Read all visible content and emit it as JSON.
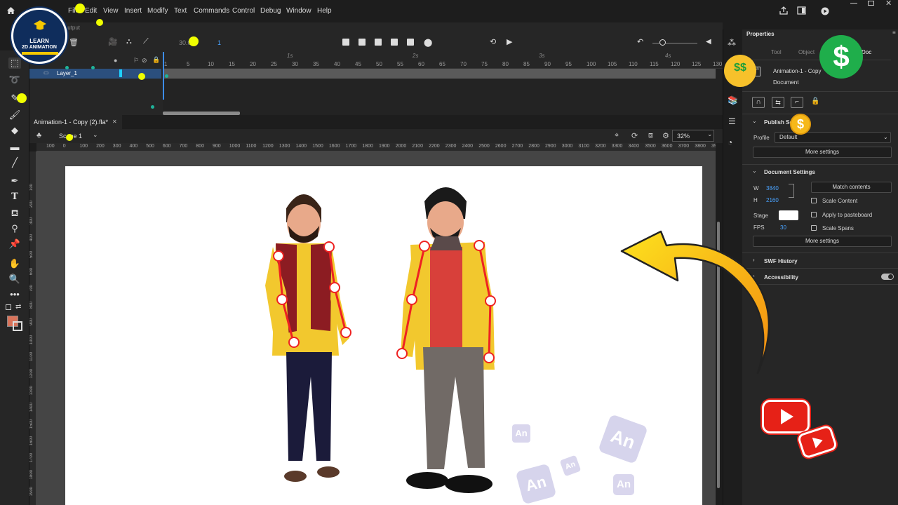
{
  "menus": [
    "File",
    "Edit",
    "View",
    "Insert",
    "Modify",
    "Text",
    "Commands",
    "Control",
    "Debug",
    "Window",
    "Help"
  ],
  "logo": {
    "line1": "LEARN",
    "line2": "2D ANIMATION"
  },
  "timeline": {
    "tab_label": "Output",
    "fps_display": "30.00",
    "frame_display": "1",
    "layer_name": "Layer_1",
    "seconds": [
      "1s",
      "2s",
      "3s",
      "4s"
    ],
    "frame_numbers": [
      "1",
      "5",
      "10",
      "15",
      "20",
      "25",
      "30",
      "35",
      "40",
      "45",
      "50",
      "55",
      "60",
      "65",
      "70",
      "75",
      "80",
      "85",
      "90",
      "95",
      "100",
      "105",
      "110",
      "115",
      "120",
      "125",
      "130"
    ]
  },
  "document": {
    "tab_title": "Animation-1 - Copy (2).fla*",
    "scene": "Scene 1",
    "zoom": "32%",
    "ruler_marks": [
      "100",
      "0",
      "100",
      "200",
      "300",
      "400",
      "500",
      "600",
      "700",
      "800",
      "900",
      "1000",
      "1100",
      "1200",
      "1300",
      "1400",
      "1500",
      "1600",
      "1700",
      "1800",
      "1900",
      "2000",
      "2100",
      "2200",
      "2300",
      "2400",
      "2500",
      "2600",
      "2700",
      "2800",
      "2900",
      "3000",
      "3100",
      "3200",
      "3300",
      "3400",
      "3500",
      "3600",
      "3700",
      "3800",
      "3900"
    ],
    "vruler_marks": [
      "100",
      "200",
      "300",
      "400",
      "500",
      "600",
      "700",
      "800",
      "900",
      "1000",
      "1100",
      "1200",
      "1300",
      "1400",
      "1500",
      "1600",
      "1700",
      "1800",
      "1900"
    ],
    "an_badge": "An"
  },
  "properties": {
    "title": "Properties",
    "tabs": [
      "Tool",
      "Object",
      "Doc"
    ],
    "doc_name": "Animation-1 - Copy",
    "doc_type": "Document",
    "publish_label": "Publish Settings",
    "profile_label": "Profile",
    "profile_value": "Default",
    "more_settings": "More settings",
    "doc_settings_label": "Document Settings",
    "w_label": "W",
    "w_value": "3840",
    "h_label": "H",
    "h_value": "2160",
    "match_contents": "Match contents",
    "scale_content": "Scale Content",
    "stage_label": "Stage",
    "apply_pasteboard": "Apply to pasteboard",
    "fps_label": "FPS",
    "fps_value": "30",
    "scale_spans": "Scale Spans",
    "swf_history": "SWF History",
    "accessibility": "Accessibility"
  },
  "colors": {
    "accent_blue": "#2b4f7d",
    "stage_white": "#ffffff",
    "fill_swatch": "#d9735a",
    "arrow_orange": "#f7a21b",
    "youtube_red": "#e62117",
    "dollar_green": "#1fae4b"
  }
}
